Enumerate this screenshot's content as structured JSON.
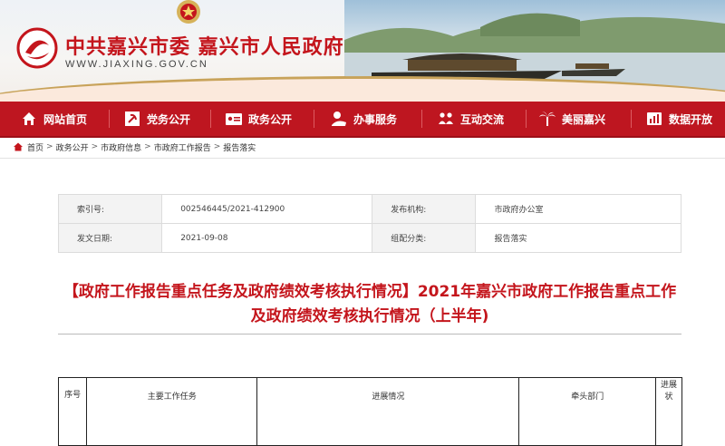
{
  "header": {
    "title": "中共嘉兴市委 嘉兴市人民政府",
    "url": "WWW.JIAXING.GOV.CN"
  },
  "nav": {
    "items": [
      {
        "label": "网站首页",
        "icon": "home-icon"
      },
      {
        "label": "党务公开",
        "icon": "party-emblem-icon"
      },
      {
        "label": "政务公开",
        "icon": "id-card-icon"
      },
      {
        "label": "办事服务",
        "icon": "service-hand-icon"
      },
      {
        "label": "互动交流",
        "icon": "people-icon"
      },
      {
        "label": "美丽嘉兴",
        "icon": "palm-tree-icon"
      },
      {
        "label": "数据开放",
        "icon": "data-chart-icon"
      }
    ]
  },
  "breadcrumb": [
    "首页",
    "政务公开",
    "市政府信息",
    "市政府工作报告",
    "报告落实"
  ],
  "info": {
    "index_label": "索引号:",
    "index_value": "002546445/2021-412900",
    "publisher_label": "发布机构:",
    "publisher_value": "市政府办公室",
    "date_label": "发文日期:",
    "date_value": "2021-09-08",
    "category_label": "组配分类:",
    "category_value": "报告落实"
  },
  "article": {
    "title": "【政府工作报告重点任务及政府绩效考核执行情况】2021年嘉兴市政府工作报告重点工作及政府绩效考核执行情况（上半年)"
  },
  "table": {
    "columns": [
      "序号",
      "主要工作任务",
      "进展情况",
      "牵头部门",
      "进展状"
    ]
  },
  "colors": {
    "brand_red": "#be1620",
    "title_red": "#c4151c"
  }
}
